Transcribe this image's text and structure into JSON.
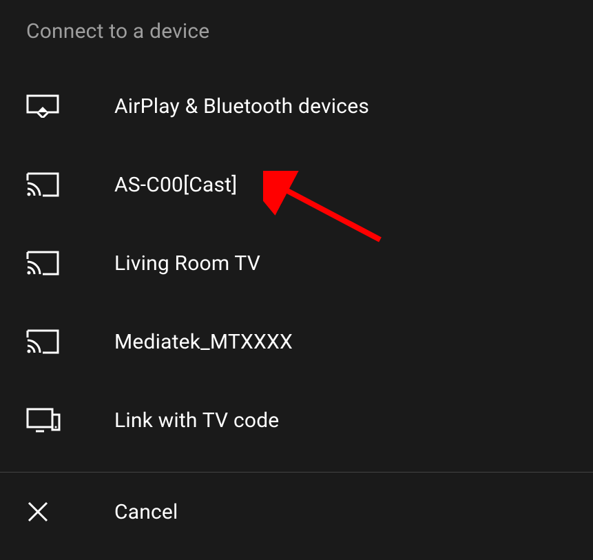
{
  "header": {
    "title": "Connect to a device"
  },
  "items": [
    {
      "label": "AirPlay & Bluetooth devices",
      "icon": "airplay-icon"
    },
    {
      "label": "AS-C00[Cast]",
      "icon": "cast-icon"
    },
    {
      "label": "Living Room TV",
      "icon": "cast-icon"
    },
    {
      "label": "Mediatek_MTXXXX",
      "icon": "cast-icon"
    },
    {
      "label": "Link with TV code",
      "icon": "tv-code-icon"
    }
  ],
  "cancel": {
    "label": "Cancel"
  },
  "annotation": {
    "arrow_color": "#ff0000"
  }
}
